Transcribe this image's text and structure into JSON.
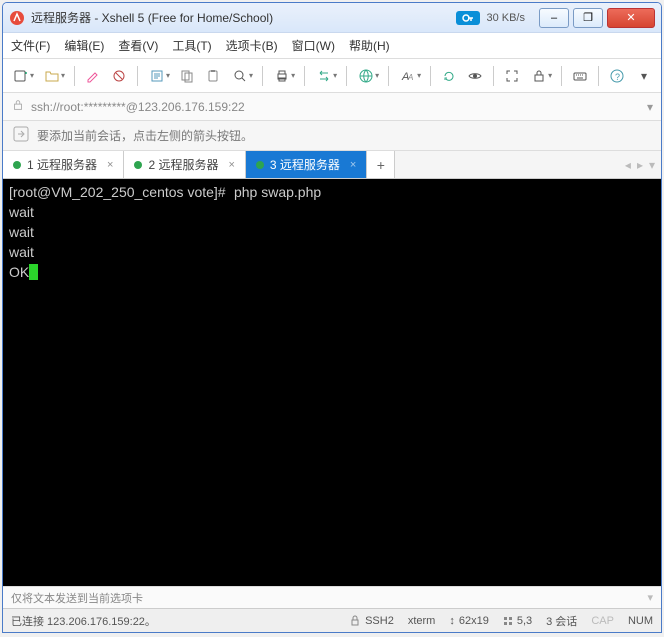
{
  "titlebar": {
    "title": "远程服务器 - Xshell 5 (Free for Home/School)",
    "net_rate": "30 KB/s"
  },
  "menubar": {
    "file": "文件(F)",
    "edit": "编辑(E)",
    "view": "查看(V)",
    "tools": "工具(T)",
    "tabs": "选项卡(B)",
    "window": "窗口(W)",
    "help": "帮助(H)"
  },
  "addressbar": {
    "url": "ssh://root:*********@123.206.176.159:22"
  },
  "tipbar": {
    "text": "要添加当前会话，点击左侧的箭头按钮。"
  },
  "tabs": [
    {
      "label": "1 远程服务器",
      "active": false
    },
    {
      "label": "2 远程服务器",
      "active": false
    },
    {
      "label": "3 远程服务器",
      "active": true
    }
  ],
  "terminal": {
    "prompt": "[root@VM_202_250_centos vote]#",
    "command": "php swap.php",
    "lines": [
      "wait",
      "wait",
      "wait",
      "OK"
    ]
  },
  "bottombar": {
    "text": "仅将文本发送到当前选项卡"
  },
  "statusbar": {
    "status": "已连接 123.206.176.159:22。",
    "protocol": "SSH2",
    "term": "xterm",
    "size": "62x19",
    "pos": "5,3",
    "sessions": "3 会话",
    "cap": "CAP",
    "num": "NUM"
  },
  "icons": {
    "min": "–",
    "max": "❐",
    "close": "✕"
  }
}
